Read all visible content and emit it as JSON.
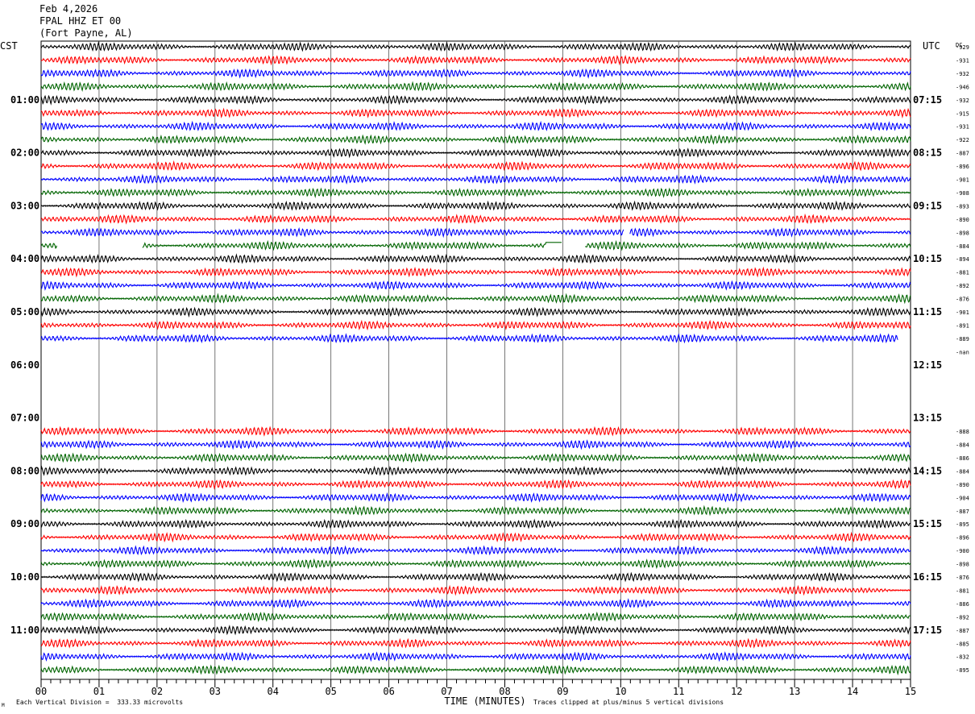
{
  "header": {
    "date": "Feb 4,2026",
    "station": "FPAL HHZ ET 00",
    "location": "(Fort Payne, AL)"
  },
  "axes": {
    "left_label": "CST",
    "right_label": "UTC",
    "dc_label": "DC",
    "xlabel": "TIME (MINUTES)"
  },
  "footer": {
    "scale_note": "Each Vertical Division =  333.33 microvolts",
    "clip_note": "Traces clipped at plus/minus 5 vertical divisions",
    "corner_mark": "M"
  },
  "chart_data": {
    "type": "line",
    "title": "Feb 4,2026 FPAL HHZ ET 00 (Fort Payne, AL)",
    "xlabel": "TIME (MINUTES)",
    "xlim": [
      0,
      15
    ],
    "x_ticks": [
      "00",
      "01",
      "02",
      "03",
      "04",
      "05",
      "06",
      "07",
      "08",
      "09",
      "10",
      "11",
      "12",
      "13",
      "14",
      "15"
    ],
    "trace_colors": [
      "#000000",
      "#ff0000",
      "#0000ff",
      "#006400"
    ],
    "left_time_labels": [
      {
        "row": 4,
        "label": "01:00"
      },
      {
        "row": 8,
        "label": "02:00"
      },
      {
        "row": 12,
        "label": "03:00"
      },
      {
        "row": 16,
        "label": "04:00"
      },
      {
        "row": 20,
        "label": "05:00"
      },
      {
        "row": 24,
        "label": "06:00"
      },
      {
        "row": 28,
        "label": "07:00"
      },
      {
        "row": 32,
        "label": "08:00"
      },
      {
        "row": 36,
        "label": "09:00"
      },
      {
        "row": 40,
        "label": "10:00"
      },
      {
        "row": 44,
        "label": "11:00"
      }
    ],
    "right_time_labels": [
      {
        "row": 4,
        "label": "07:15"
      },
      {
        "row": 8,
        "label": "08:15"
      },
      {
        "row": 12,
        "label": "09:15"
      },
      {
        "row": 16,
        "label": "10:15"
      },
      {
        "row": 20,
        "label": "11:15"
      },
      {
        "row": 24,
        "label": "12:15"
      },
      {
        "row": 28,
        "label": "13:15"
      },
      {
        "row": 32,
        "label": "14:15"
      },
      {
        "row": 36,
        "label": "15:15"
      },
      {
        "row": 40,
        "label": "16:15"
      },
      {
        "row": 44,
        "label": "17:15"
      }
    ],
    "dc_values": [
      "-929",
      "-931",
      "-932",
      "-946",
      "-932",
      "-915",
      "-931",
      "-922",
      "-887",
      "-896",
      "-901",
      "-908",
      "-893",
      "-890",
      "-898",
      "-884",
      "-894",
      "-881",
      "-892",
      "-876",
      "-901",
      "-891",
      "-889",
      "-nan",
      null,
      null,
      null,
      null,
      null,
      "-888",
      "-884",
      "-886",
      "-884",
      "-890",
      "-904",
      "-887",
      "-895",
      "-896",
      "-900",
      "-898",
      "-876",
      "-881",
      "-886",
      "-892",
      "-887",
      "-885",
      "-832",
      "-895"
    ],
    "rows": [
      {
        "row": 0,
        "color": "#000000"
      },
      {
        "row": 1,
        "color": "#ff0000"
      },
      {
        "row": 2,
        "color": "#0000ff"
      },
      {
        "row": 3,
        "color": "#006400"
      },
      {
        "row": 4,
        "color": "#000000"
      },
      {
        "row": 5,
        "color": "#ff0000"
      },
      {
        "row": 6,
        "color": "#0000ff"
      },
      {
        "row": 7,
        "color": "#006400"
      },
      {
        "row": 8,
        "color": "#000000"
      },
      {
        "row": 9,
        "color": "#ff0000"
      },
      {
        "row": 10,
        "color": "#0000ff"
      },
      {
        "row": 11,
        "color": "#006400"
      },
      {
        "row": 12,
        "color": "#000000"
      },
      {
        "row": 13,
        "color": "#ff0000"
      },
      {
        "row": 14,
        "color": "#0000ff",
        "gaps": [
          [
            10.05,
            10.15
          ]
        ]
      },
      {
        "row": 15,
        "color": "#006400",
        "gaps": [
          [
            0.28,
            1.75
          ],
          [
            8.98,
            9.38
          ]
        ],
        "flat": [
          [
            8.7,
            8.98
          ]
        ]
      },
      {
        "row": 16,
        "color": "#000000"
      },
      {
        "row": 17,
        "color": "#ff0000"
      },
      {
        "row": 18,
        "color": "#0000ff"
      },
      {
        "row": 19,
        "color": "#006400"
      },
      {
        "row": 20,
        "color": "#000000"
      },
      {
        "row": 21,
        "color": "#ff0000"
      },
      {
        "row": 22,
        "color": "#0000ff",
        "end": 14.78
      },
      {
        "row": 29,
        "color": "#ff0000"
      },
      {
        "row": 30,
        "color": "#0000ff"
      },
      {
        "row": 31,
        "color": "#006400"
      },
      {
        "row": 32,
        "color": "#000000"
      },
      {
        "row": 33,
        "color": "#ff0000"
      },
      {
        "row": 34,
        "color": "#0000ff"
      },
      {
        "row": 35,
        "color": "#006400"
      },
      {
        "row": 36,
        "color": "#000000"
      },
      {
        "row": 37,
        "color": "#ff0000"
      },
      {
        "row": 38,
        "color": "#0000ff"
      },
      {
        "row": 39,
        "color": "#006400"
      },
      {
        "row": 40,
        "color": "#000000"
      },
      {
        "row": 41,
        "color": "#ff0000"
      },
      {
        "row": 42,
        "color": "#0000ff"
      },
      {
        "row": 43,
        "color": "#006400"
      },
      {
        "row": 44,
        "color": "#000000"
      },
      {
        "row": 45,
        "color": "#ff0000"
      },
      {
        "row": 46,
        "color": "#0000ff"
      },
      {
        "row": 47,
        "color": "#006400"
      }
    ]
  }
}
